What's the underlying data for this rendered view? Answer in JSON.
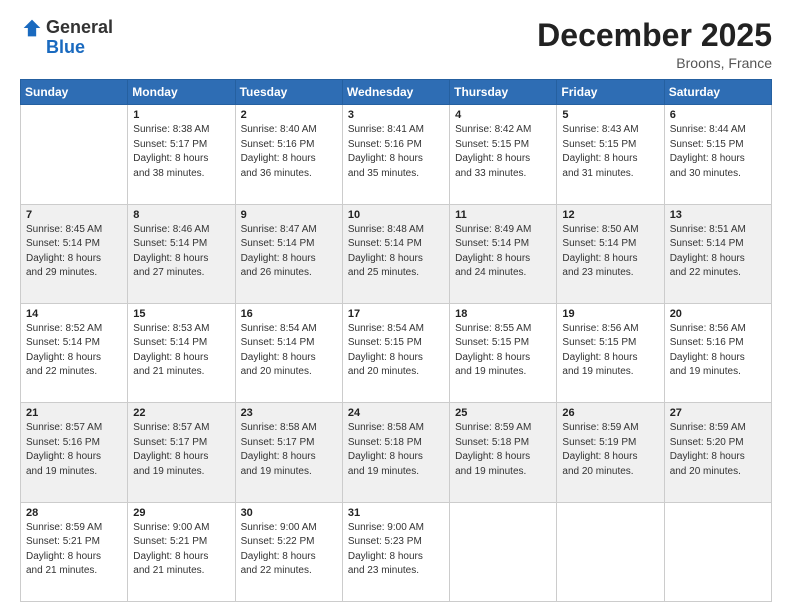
{
  "logo": {
    "general": "General",
    "blue": "Blue"
  },
  "header": {
    "month": "December 2025",
    "location": "Broons, France"
  },
  "weekdays": [
    "Sunday",
    "Monday",
    "Tuesday",
    "Wednesday",
    "Thursday",
    "Friday",
    "Saturday"
  ],
  "weeks": [
    [
      {
        "day": "",
        "info": ""
      },
      {
        "day": "1",
        "info": "Sunrise: 8:38 AM\nSunset: 5:17 PM\nDaylight: 8 hours\nand 38 minutes."
      },
      {
        "day": "2",
        "info": "Sunrise: 8:40 AM\nSunset: 5:16 PM\nDaylight: 8 hours\nand 36 minutes."
      },
      {
        "day": "3",
        "info": "Sunrise: 8:41 AM\nSunset: 5:16 PM\nDaylight: 8 hours\nand 35 minutes."
      },
      {
        "day": "4",
        "info": "Sunrise: 8:42 AM\nSunset: 5:15 PM\nDaylight: 8 hours\nand 33 minutes."
      },
      {
        "day": "5",
        "info": "Sunrise: 8:43 AM\nSunset: 5:15 PM\nDaylight: 8 hours\nand 31 minutes."
      },
      {
        "day": "6",
        "info": "Sunrise: 8:44 AM\nSunset: 5:15 PM\nDaylight: 8 hours\nand 30 minutes."
      }
    ],
    [
      {
        "day": "7",
        "info": "Sunrise: 8:45 AM\nSunset: 5:14 PM\nDaylight: 8 hours\nand 29 minutes."
      },
      {
        "day": "8",
        "info": "Sunrise: 8:46 AM\nSunset: 5:14 PM\nDaylight: 8 hours\nand 27 minutes."
      },
      {
        "day": "9",
        "info": "Sunrise: 8:47 AM\nSunset: 5:14 PM\nDaylight: 8 hours\nand 26 minutes."
      },
      {
        "day": "10",
        "info": "Sunrise: 8:48 AM\nSunset: 5:14 PM\nDaylight: 8 hours\nand 25 minutes."
      },
      {
        "day": "11",
        "info": "Sunrise: 8:49 AM\nSunset: 5:14 PM\nDaylight: 8 hours\nand 24 minutes."
      },
      {
        "day": "12",
        "info": "Sunrise: 8:50 AM\nSunset: 5:14 PM\nDaylight: 8 hours\nand 23 minutes."
      },
      {
        "day": "13",
        "info": "Sunrise: 8:51 AM\nSunset: 5:14 PM\nDaylight: 8 hours\nand 22 minutes."
      }
    ],
    [
      {
        "day": "14",
        "info": "Sunrise: 8:52 AM\nSunset: 5:14 PM\nDaylight: 8 hours\nand 22 minutes."
      },
      {
        "day": "15",
        "info": "Sunrise: 8:53 AM\nSunset: 5:14 PM\nDaylight: 8 hours\nand 21 minutes."
      },
      {
        "day": "16",
        "info": "Sunrise: 8:54 AM\nSunset: 5:14 PM\nDaylight: 8 hours\nand 20 minutes."
      },
      {
        "day": "17",
        "info": "Sunrise: 8:54 AM\nSunset: 5:15 PM\nDaylight: 8 hours\nand 20 minutes."
      },
      {
        "day": "18",
        "info": "Sunrise: 8:55 AM\nSunset: 5:15 PM\nDaylight: 8 hours\nand 19 minutes."
      },
      {
        "day": "19",
        "info": "Sunrise: 8:56 AM\nSunset: 5:15 PM\nDaylight: 8 hours\nand 19 minutes."
      },
      {
        "day": "20",
        "info": "Sunrise: 8:56 AM\nSunset: 5:16 PM\nDaylight: 8 hours\nand 19 minutes."
      }
    ],
    [
      {
        "day": "21",
        "info": "Sunrise: 8:57 AM\nSunset: 5:16 PM\nDaylight: 8 hours\nand 19 minutes."
      },
      {
        "day": "22",
        "info": "Sunrise: 8:57 AM\nSunset: 5:17 PM\nDaylight: 8 hours\nand 19 minutes."
      },
      {
        "day": "23",
        "info": "Sunrise: 8:58 AM\nSunset: 5:17 PM\nDaylight: 8 hours\nand 19 minutes."
      },
      {
        "day": "24",
        "info": "Sunrise: 8:58 AM\nSunset: 5:18 PM\nDaylight: 8 hours\nand 19 minutes."
      },
      {
        "day": "25",
        "info": "Sunrise: 8:59 AM\nSunset: 5:18 PM\nDaylight: 8 hours\nand 19 minutes."
      },
      {
        "day": "26",
        "info": "Sunrise: 8:59 AM\nSunset: 5:19 PM\nDaylight: 8 hours\nand 20 minutes."
      },
      {
        "day": "27",
        "info": "Sunrise: 8:59 AM\nSunset: 5:20 PM\nDaylight: 8 hours\nand 20 minutes."
      }
    ],
    [
      {
        "day": "28",
        "info": "Sunrise: 8:59 AM\nSunset: 5:21 PM\nDaylight: 8 hours\nand 21 minutes."
      },
      {
        "day": "29",
        "info": "Sunrise: 9:00 AM\nSunset: 5:21 PM\nDaylight: 8 hours\nand 21 minutes."
      },
      {
        "day": "30",
        "info": "Sunrise: 9:00 AM\nSunset: 5:22 PM\nDaylight: 8 hours\nand 22 minutes."
      },
      {
        "day": "31",
        "info": "Sunrise: 9:00 AM\nSunset: 5:23 PM\nDaylight: 8 hours\nand 23 minutes."
      },
      {
        "day": "",
        "info": ""
      },
      {
        "day": "",
        "info": ""
      },
      {
        "day": "",
        "info": ""
      }
    ]
  ]
}
